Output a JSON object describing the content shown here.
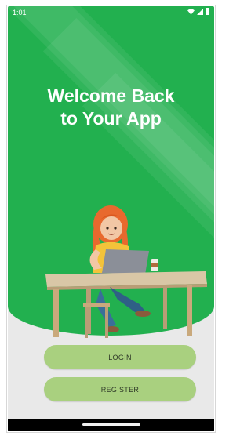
{
  "status_bar": {
    "time": "1:01",
    "icons": [
      "wifi-icon",
      "signal-icon",
      "battery-icon"
    ]
  },
  "hero": {
    "title_line1": "Welcome Back",
    "title_line2": "to Your App",
    "background_color": "#22b04f"
  },
  "buttons": {
    "login_label": "LOGIN",
    "register_label": "REGISTER",
    "color": "#a9d07f"
  },
  "illustration": "girl-with-laptop-at-desk"
}
